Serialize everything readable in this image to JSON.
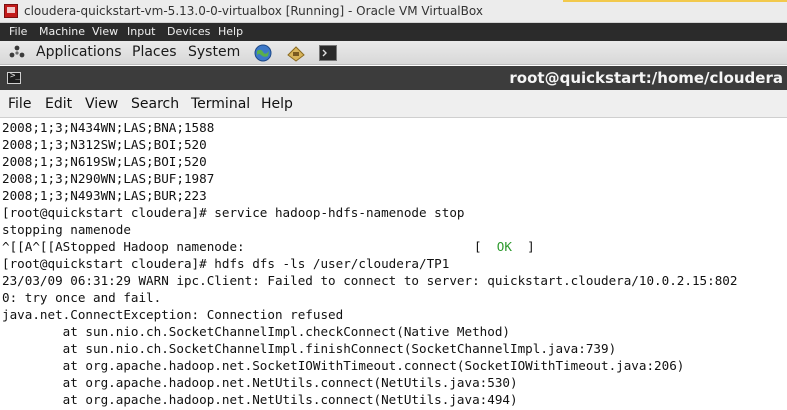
{
  "vbox": {
    "title": "cloudera-quickstart-vm-5.13.0-0-virtualbox [Running] - Oracle VM VirtualBox",
    "menu": [
      "File",
      "Machine",
      "View",
      "Input",
      "Devices",
      "Help"
    ]
  },
  "panel": {
    "items": [
      "Applications",
      "Places",
      "System"
    ],
    "launchers": [
      "browser-icon",
      "network-icon",
      "terminal-icon"
    ]
  },
  "terminal": {
    "title": "root@quickstart:/home/cloudera",
    "menu": [
      "File",
      "Edit",
      "View",
      "Search",
      "Terminal",
      "Help"
    ],
    "lines": [
      "2008;1;3;N434WN;LAS;BNA;1588",
      "2008;1;3;N312SW;LAS;BOI;520",
      "2008;1;3;N619SW;LAS;BOI;520",
      "2008;1;3;N290WN;LAS;BUF;1987",
      "2008;1;3;N493WN;LAS;BUR;223",
      "[root@quickstart cloudera]# service hadoop-hdfs-namenode stop",
      "stopping namenode",
      "^[[A^[[AStopped Hadoop namenode:",
      "[root@quickstart cloudera]# hdfs dfs -ls /user/cloudera/TP1",
      "23/03/09 06:31:29 WARN ipc.Client: Failed to connect to server: quickstart.cloudera/10.0.2.15:802",
      "0: try once and fail.",
      "java.net.ConnectException: Connection refused",
      "        at sun.nio.ch.SocketChannelImpl.checkConnect(Native Method)",
      "        at sun.nio.ch.SocketChannelImpl.finishConnect(SocketChannelImpl.java:739)",
      "        at org.apache.hadoop.net.SocketIOWithTimeout.connect(SocketIOWithTimeout.java:206)",
      "        at org.apache.hadoop.net.NetUtils.connect(NetUtils.java:530)",
      "        at org.apache.hadoop.net.NetUtils.connect(NetUtils.java:494)"
    ],
    "ok_open": "[",
    "ok_text": "OK",
    "ok_close": "]"
  },
  "colors": {
    "ok": "#2e9a2e",
    "vbox_menubar": "#2b2b2b",
    "terminal_titlebar": "#3c3c3c"
  }
}
